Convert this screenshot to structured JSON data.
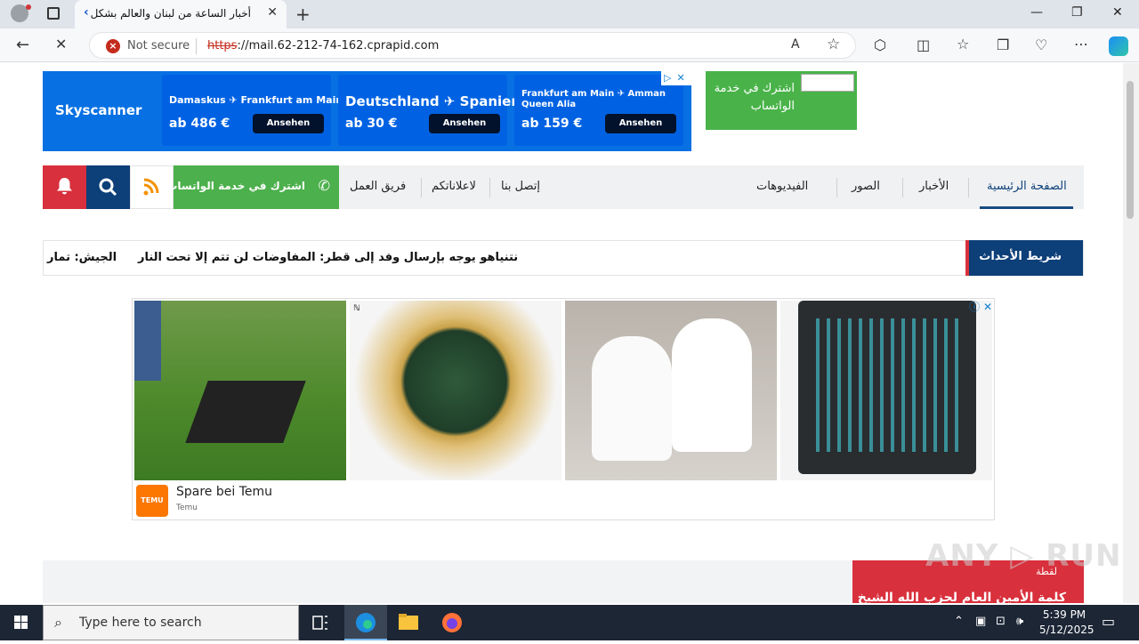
{
  "browser": {
    "tab_title": "أخبار الساعة من لبنان والعالم بشكل",
    "tab_close": "✕",
    "new_tab": "+",
    "security_label": "Not secure",
    "url_scheme": "https",
    "url_rest": "://mail.62-212-74-162.cprapid.com",
    "win_min": "—",
    "win_max": "❐",
    "win_close": "✕"
  },
  "ads": {
    "skyscanner": {
      "logo": "Skyscanner",
      "cards": [
        {
          "route": "Damaskus ✈ Frankfurt am Main",
          "price": "ab 486 €",
          "button": "Ansehen"
        },
        {
          "route": "Deutschland ✈ Spanien",
          "price": "ab 30 €",
          "button": "Ansehen"
        },
        {
          "route": "Frankfurt am Main ✈ Amman Queen Alia",
          "price": "ab 159 €",
          "button": "Ansehen"
        }
      ]
    },
    "whatsapp_box": "اشترك في خدمة الواتساب",
    "temu": {
      "headline": "Spare bei Temu",
      "source": "Temu",
      "logo": "TEMU"
    }
  },
  "nav": {
    "home": "الصفحة الرئيسية",
    "news": "الأخبار",
    "photos": "الصور",
    "videos": "الفيديوهات",
    "contact": "إتصل بنا",
    "ads": "لاعلاناتكم",
    "team": "فريق العمل",
    "whatsapp_subscribe": "اشترك في خدمة الواتساب"
  },
  "ticker": {
    "label": "شريط الأحداث",
    "items": [
      "نتنياهو يوجه بإرسال وفد إلى قطر: المفاوضات لن تتم إلا تحت النار",
      "الجيش: تمار"
    ]
  },
  "bottom": {
    "tag": "لقطة",
    "headline": "كلمة الأمين العام لحزب الله الشيخ"
  },
  "taskbar": {
    "search_placeholder": "Type here to search",
    "time": "5:39 PM",
    "date": "5/12/2025"
  },
  "colors": {
    "nav_blue": "#0d3f78",
    "accent_red": "#d8303c",
    "whatsapp_green": "#4cb04c",
    "sky_blue": "#0770e3"
  }
}
